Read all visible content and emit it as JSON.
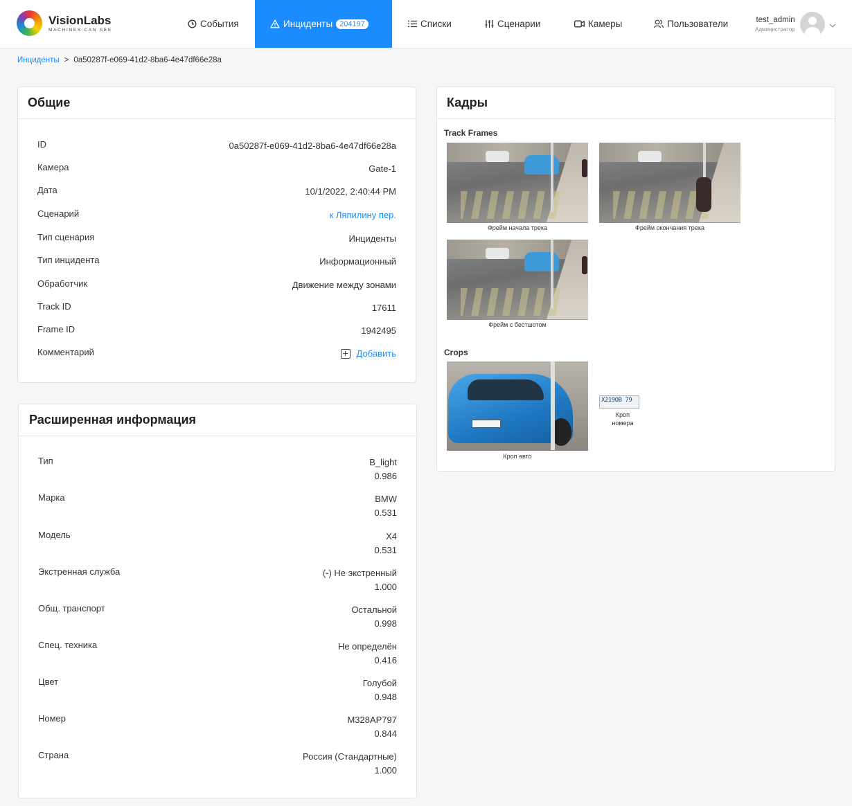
{
  "brand": {
    "name": "VisionLabs",
    "tagline": "MACHINES CAN SEE"
  },
  "nav": {
    "events": "События",
    "incidents": "Инциденты",
    "incidents_count": "204197",
    "lists": "Списки",
    "scenarios": "Сценарии",
    "cameras": "Камеры",
    "users": "Пользователи"
  },
  "user": {
    "name": "test_admin",
    "role": "Администратор"
  },
  "breadcrumb": {
    "root": "Инциденты",
    "sep": ">",
    "current": "0a50287f-e069-41d2-8ba6-4e47df66e28a"
  },
  "general": {
    "title": "Общие",
    "rows": [
      {
        "label": "ID",
        "value": "0a50287f-e069-41d2-8ba6-4e47df66e28a"
      },
      {
        "label": "Камера",
        "value": "Gate-1"
      },
      {
        "label": "Дата",
        "value": "10/1/2022, 2:40:44 PM"
      },
      {
        "label": "Сценарий",
        "value": "к Ляпилину пер."
      },
      {
        "label": "Тип сценария",
        "value": "Инциденты"
      },
      {
        "label": "Тип инцидента",
        "value": "Информационный"
      },
      {
        "label": "Обработчик",
        "value": "Движение между зонами"
      },
      {
        "label": "Track ID",
        "value": "17611"
      },
      {
        "label": "Frame ID",
        "value": "1942495"
      },
      {
        "label": "Комментарий",
        "value": "Добавить"
      }
    ]
  },
  "extended": {
    "title": "Расширенная информация",
    "rows": [
      {
        "label": "Тип",
        "value": "B_light",
        "score": "0.986"
      },
      {
        "label": "Марка",
        "value": "BMW",
        "score": "0.531"
      },
      {
        "label": "Модель",
        "value": "X4",
        "score": "0.531"
      },
      {
        "label": "Экстренная служба",
        "value": "(-) Не экстренный",
        "score": "1.000"
      },
      {
        "label": "Общ. транспорт",
        "value": "Остальной",
        "score": "0.998"
      },
      {
        "label": "Спец. техника",
        "value": "Не определён",
        "score": "0.416"
      },
      {
        "label": "Цвет",
        "value": "Голубой",
        "score": "0.948"
      },
      {
        "label": "Номер",
        "value": "M328AP797",
        "score": "0.844"
      },
      {
        "label": "Страна",
        "value": "Россия (Стандартные)",
        "score": "1.000"
      }
    ]
  },
  "frames": {
    "title": "Кадры",
    "track_label": "Track Frames",
    "track": [
      {
        "caption": "Фрейм начала трека"
      },
      {
        "caption": "Фрейм окончания трека"
      },
      {
        "caption": "Фрейм с бестшотом"
      }
    ],
    "crops_label": "Crops",
    "crops": [
      {
        "caption": "Кроп авто"
      },
      {
        "caption_line1": "Кроп",
        "caption_line2": "номера",
        "plate_text": "X219OB 79"
      }
    ]
  }
}
